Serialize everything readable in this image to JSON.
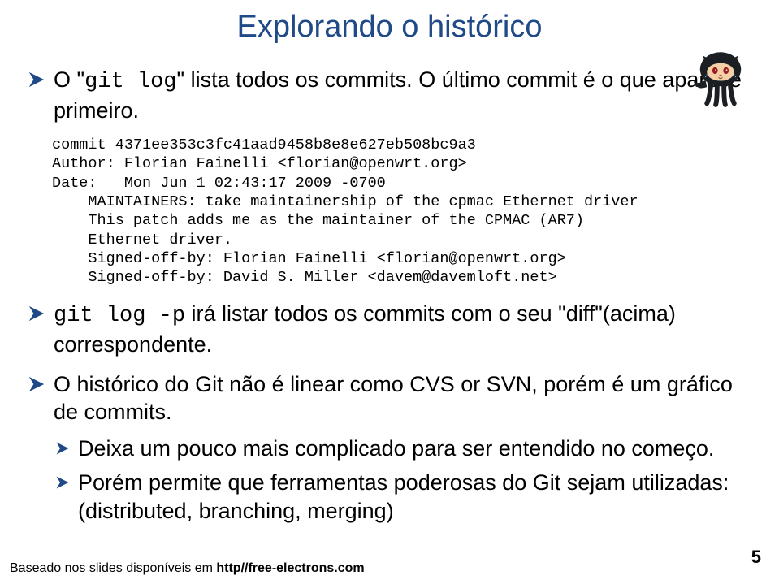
{
  "title": "Explorando o histórico",
  "bullets": {
    "b1_pre": "O \"",
    "b1_code": "git log",
    "b1_post": "\" lista todos os commits. O último commit é o que aparece primeiro.",
    "code_block": "commit 4371ee353c3fc41aad9458b8e8e627eb508bc9a3\nAuthor: Florian Fainelli <florian@openwrt.org>\nDate:   Mon Jun 1 02:43:17 2009 -0700\n    MAINTAINERS: take maintainership of the cpmac Ethernet driver\n    This patch adds me as the maintainer of the CPMAC (AR7)\n    Ethernet driver.\n    Signed-off-by: Florian Fainelli <florian@openwrt.org>\n    Signed-off-by: David S. Miller <davem@davemloft.net>",
    "b2_code": "git log -p",
    "b2_post": " irá listar todos os commits com o seu \"diff\"(acima) correspondente.",
    "b3": "O histórico do Git não é linear como CVS or SVN, porém é um gráfico de commits.",
    "b3a": "Deixa um pouco mais complicado para ser entendido no começo.",
    "b3b": "Porém permite que ferramentas poderosas do Git sejam utilizadas: (distributed, branching, merging)"
  },
  "footer_pre": "Baseado nos slides disponíveis em ",
  "footer_url": "http//free-electrons.com",
  "page_number": "5"
}
